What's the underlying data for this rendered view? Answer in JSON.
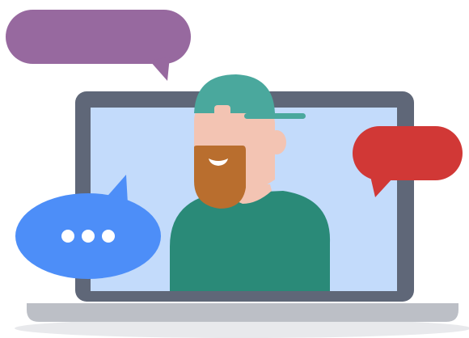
{
  "illustration": {
    "subject": "video-call",
    "icons": {
      "laptop": "laptop-icon",
      "person": "person-avatar",
      "purple_bubble": "speech-bubble-icon",
      "red_bubble": "speech-bubble-icon",
      "blue_bubble": "typing-indicator-icon"
    }
  },
  "colors": {
    "purple_bubble": "#97699f",
    "red_bubble": "#d13836",
    "blue_bubble": "#4d8ef8",
    "typing_dots": "#ffffff",
    "laptop_frame": "#5f6778",
    "laptop_screen": "#c3dbfb",
    "laptop_base": "#bcbfc6",
    "laptop_shadow": "#e8e9ec",
    "cap": "#4aa89d",
    "skin": "#f3c4b3",
    "beard": "#b96e2e",
    "shirt": "#2a8a78",
    "smile": "#ffffff"
  }
}
